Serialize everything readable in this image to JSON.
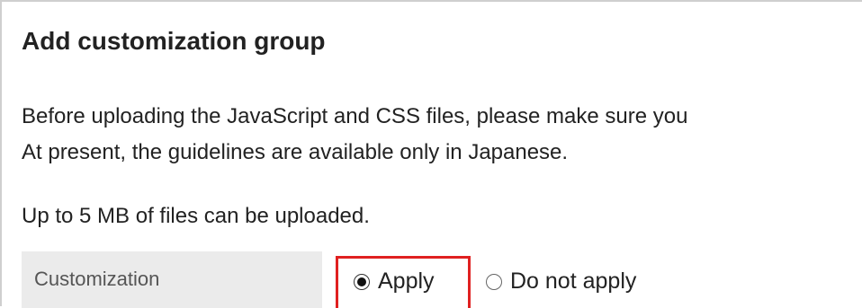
{
  "dialog": {
    "title": "Add customization group",
    "notice_line1": "Before uploading the JavaScript and CSS files, please make sure you",
    "notice_line2": "At present, the guidelines are available only in Japanese.",
    "upload_limit": "Up to 5 MB of files can be uploaded."
  },
  "form": {
    "customization": {
      "label": "Customization",
      "options": [
        {
          "label": "Apply",
          "selected": true
        },
        {
          "label": "Do not apply",
          "selected": false
        }
      ]
    }
  },
  "colors": {
    "highlight": "#e02020",
    "label_bg": "#ebebeb"
  }
}
